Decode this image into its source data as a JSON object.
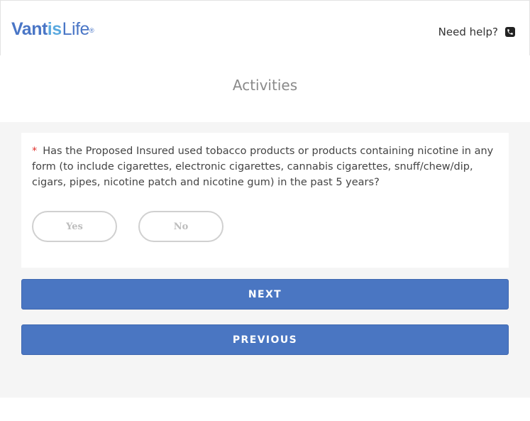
{
  "header": {
    "logo": {
      "part1": "Vantis",
      "part2": "is",
      "part3": "Life",
      "reg": "®"
    },
    "help_text": "Need help?",
    "help_icon": "phone-icon"
  },
  "page": {
    "title": "Activities"
  },
  "question": {
    "required_marker": "*",
    "text": "Has the Proposed Insured used tobacco products or products containing nicotine in any form (to include cigarettes, electronic cigarettes, cannabis cigarettes, snuff/chew/dip, cigars, pipes, nicotine patch and nicotine gum) in the past 5 years?",
    "options": [
      "Yes",
      "No"
    ]
  },
  "buttons": {
    "next": "NEXT",
    "previous": "PREVIOUS"
  },
  "colors": {
    "brand_blue": "#4a76c6",
    "brand_light_blue": "#5aa9df",
    "button_blue": "#4a76c2",
    "required_red": "#e0302c",
    "background_gray": "#f5f5f5"
  }
}
